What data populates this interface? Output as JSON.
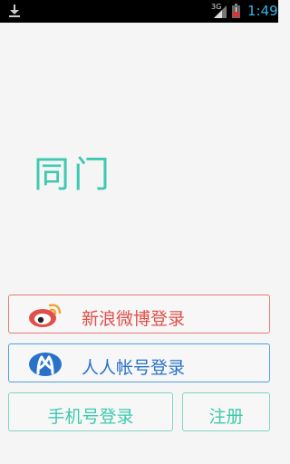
{
  "status_bar": {
    "network": "3G",
    "time": "1:49",
    "icons": [
      "download-icon",
      "signal-icon",
      "battery-icon"
    ]
  },
  "app": {
    "title": "同门"
  },
  "login": {
    "weibo_label": "新浪微博登录",
    "renren_label": "人人帐号登录",
    "phone_label": "手机号登录",
    "register_label": "注册"
  },
  "colors": {
    "accent": "#3ec9b0",
    "weibo": "#e0504a",
    "renren": "#2a72c9",
    "clock": "#33b5e5"
  }
}
